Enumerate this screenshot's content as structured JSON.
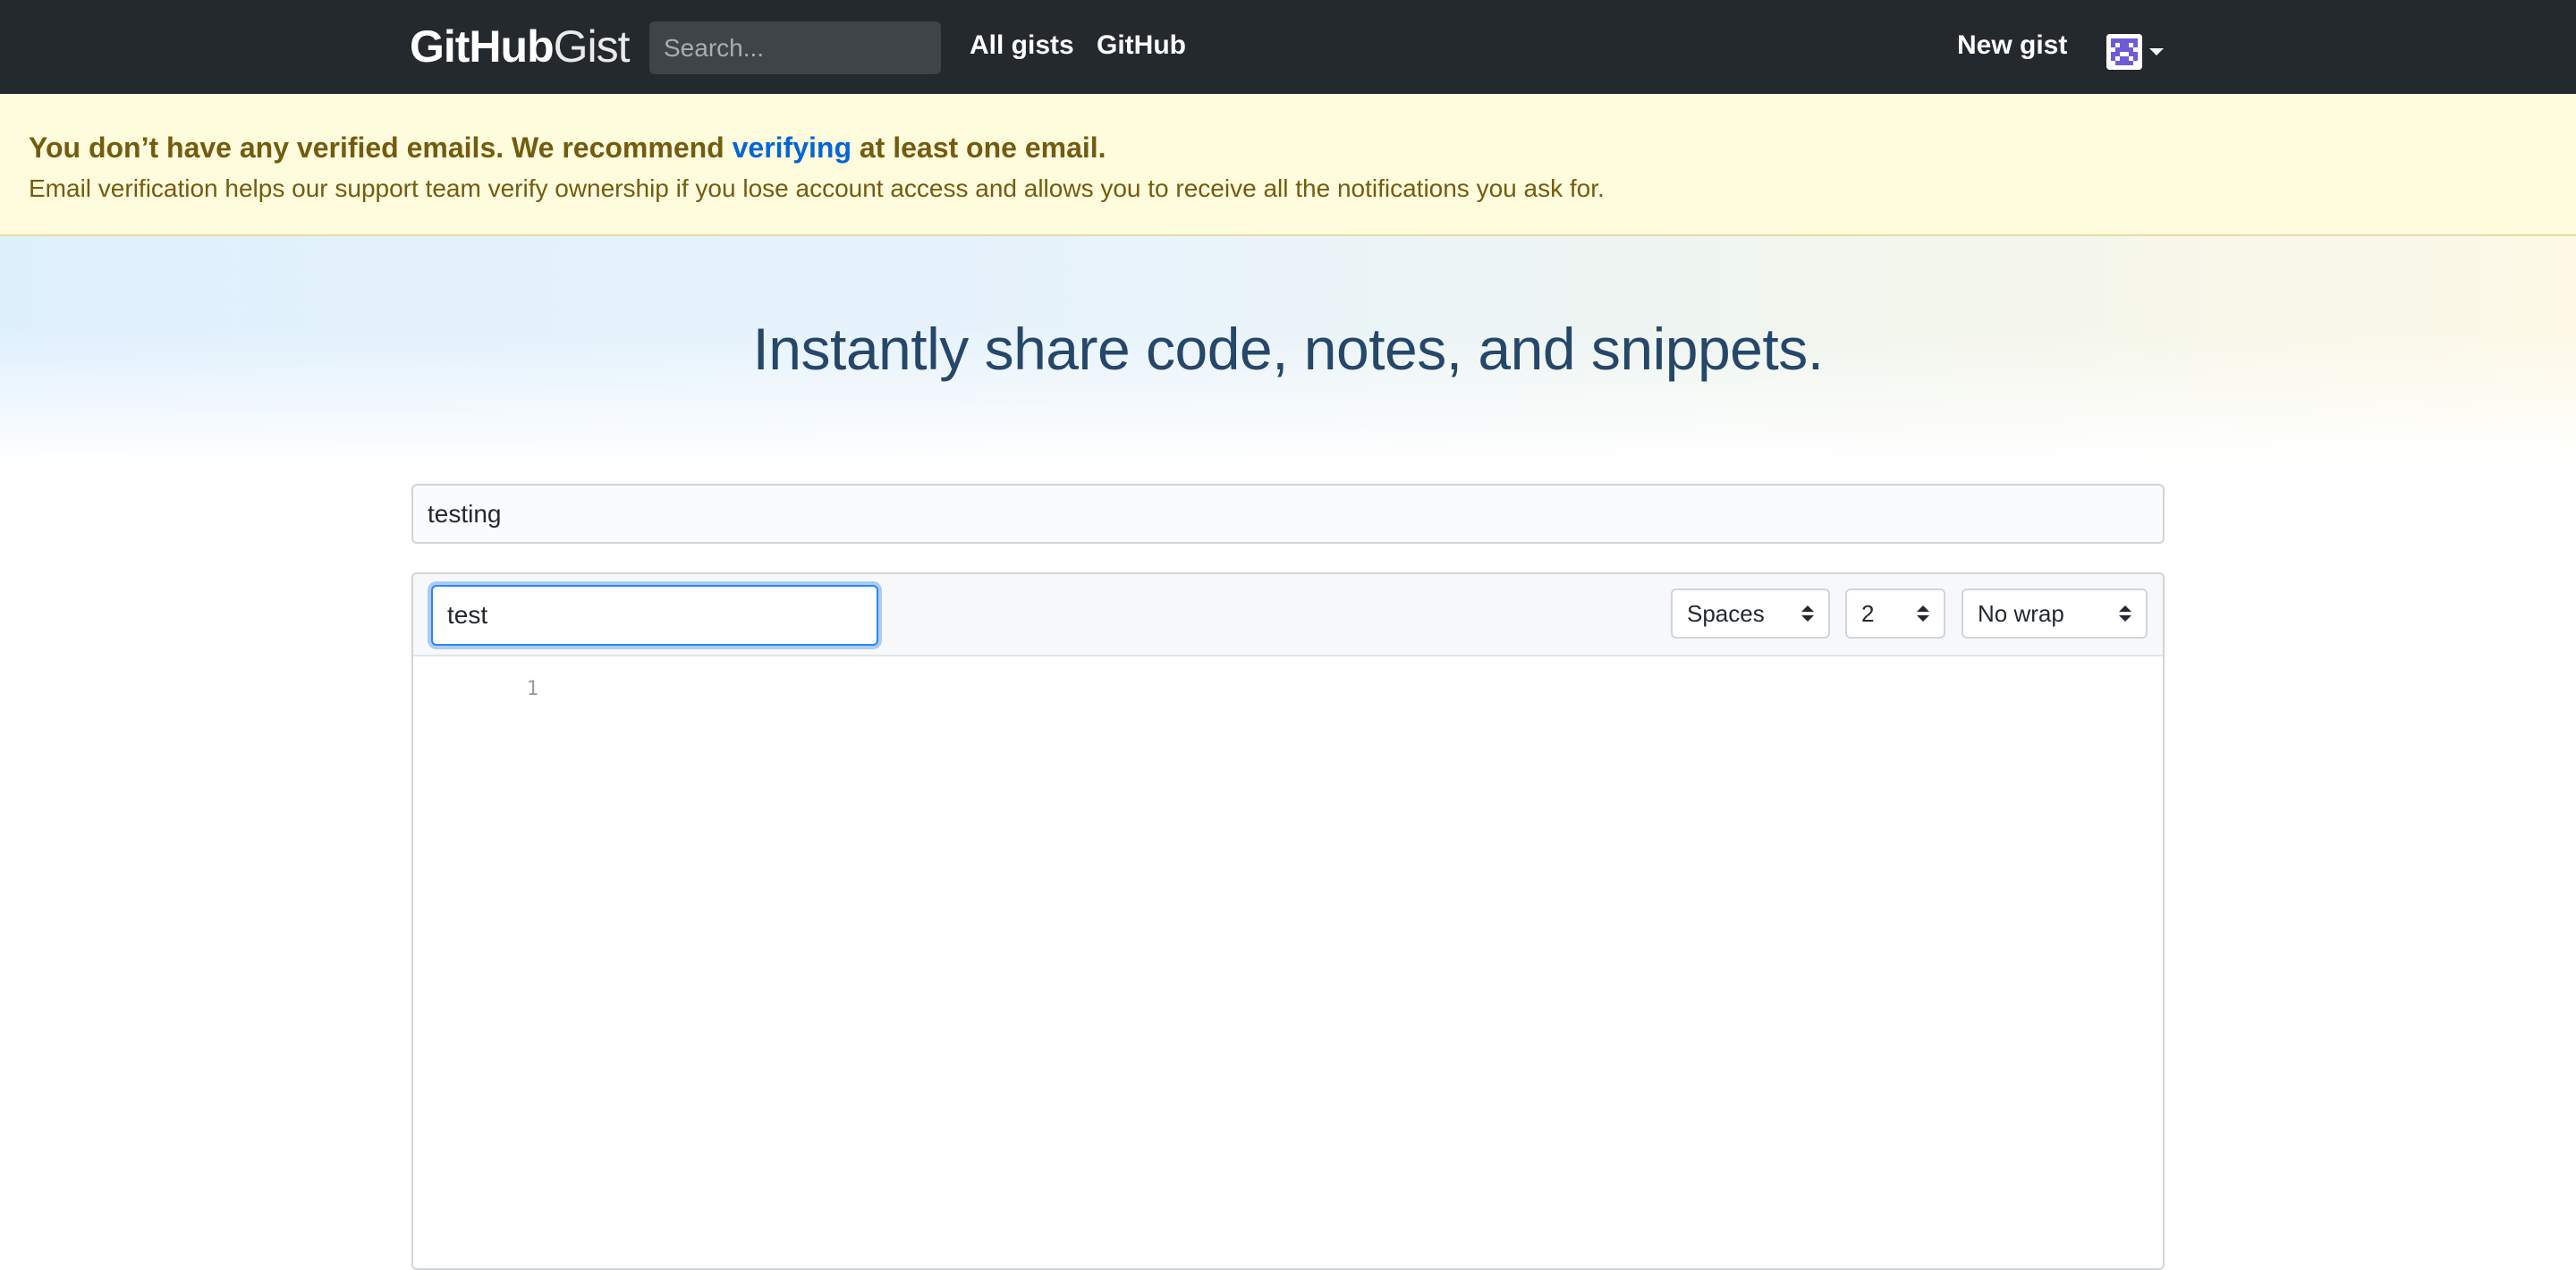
{
  "header": {
    "logo": {
      "bold": "GitHub",
      "light": "Gist"
    },
    "search_placeholder": "Search...",
    "nav": {
      "all_gists": "All gists",
      "github": "GitHub",
      "new_gist": "New gist"
    },
    "avatar_icon": "avatar-icon",
    "caret_icon": "caret-down-icon"
  },
  "banner": {
    "title_before": "You don’t have any verified emails. We recommend ",
    "title_link": "verifying",
    "title_after": " at least one email.",
    "description": "Email verification helps our support team verify ownership if you lose account access and allows you to receive all the notifications you ask for."
  },
  "hero": {
    "title": "Instantly share code, notes, and snippets."
  },
  "gist": {
    "description_value": "testing",
    "filename_value": "test",
    "indent_mode": "Spaces",
    "indent_size": "2",
    "wrap_mode": "No wrap",
    "line_numbers": [
      "1"
    ]
  },
  "colors": {
    "header_bg": "#24292e",
    "banner_bg": "#fffbdd",
    "banner_text": "#735c0f",
    "link": "#0366d6",
    "hero_title": "#25476a",
    "focus_border": "#2188ff"
  }
}
